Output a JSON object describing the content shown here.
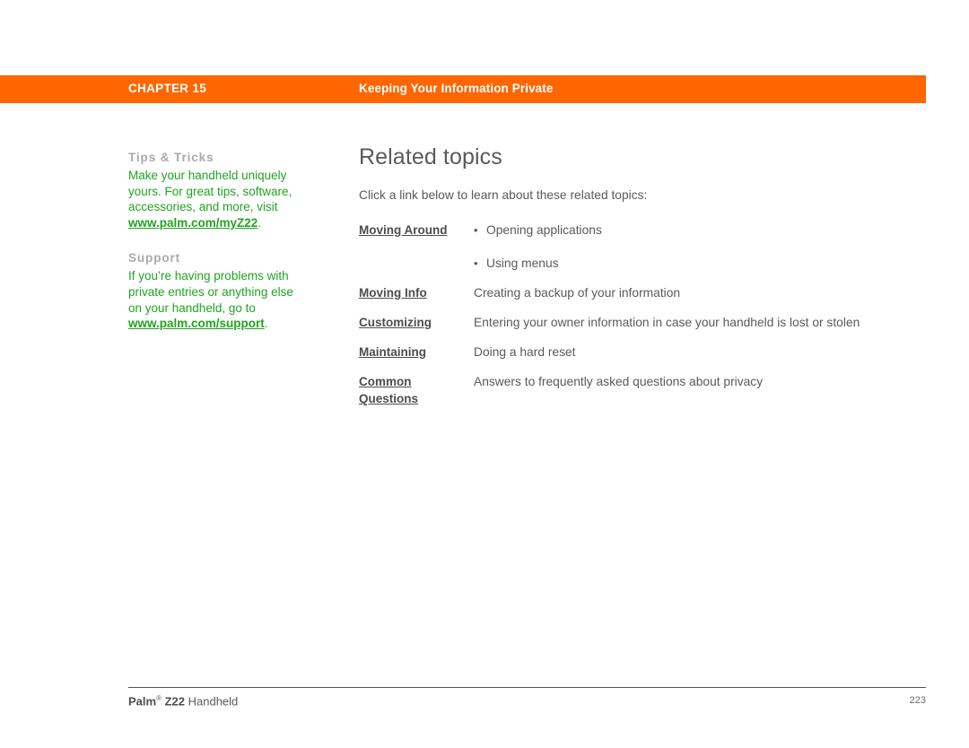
{
  "header": {
    "chapter_label": "CHAPTER 15",
    "subject": "Keeping Your Information Private",
    "bar_color": "#ff6600"
  },
  "sidebar": {
    "blocks": [
      {
        "heading": "Tips & Tricks",
        "body": "Make your handheld uniquely yours. For great tips, software, accessories, and more, visit ",
        "link": "www.palm.com/myZ22",
        "period": "."
      },
      {
        "heading": "Support",
        "body": "If you’re having problems with private entries or anything else on your handheld, go to ",
        "link": "www.palm.com/support",
        "period": "."
      }
    ],
    "text_color": "#22a322",
    "heading_color": "#aaaaaa"
  },
  "main": {
    "title": "Related topics",
    "intro": "Click a link below to learn about these related topics:",
    "topics": [
      {
        "link": "Moving Around",
        "link_line2": "",
        "bullets": [
          "Opening applications",
          "Using menus"
        ],
        "description": ""
      },
      {
        "link": "Moving Info",
        "link_line2": "",
        "bullets": [],
        "description": "Creating a backup of your information"
      },
      {
        "link": "Customizing",
        "link_line2": "",
        "bullets": [],
        "description": "Entering your owner information in case your handheld is lost or stolen"
      },
      {
        "link": "Maintaining",
        "link_line2": "",
        "bullets": [],
        "description": "Doing a hard reset"
      },
      {
        "link": "Common ",
        "link_line2": "Questions",
        "bullets": [],
        "description": "Answers to frequently asked questions about privacy"
      }
    ]
  },
  "footer": {
    "brand": "Palm",
    "registered_mark": "®",
    "model": "Z22",
    "product": " Handheld",
    "page_number": "223"
  }
}
